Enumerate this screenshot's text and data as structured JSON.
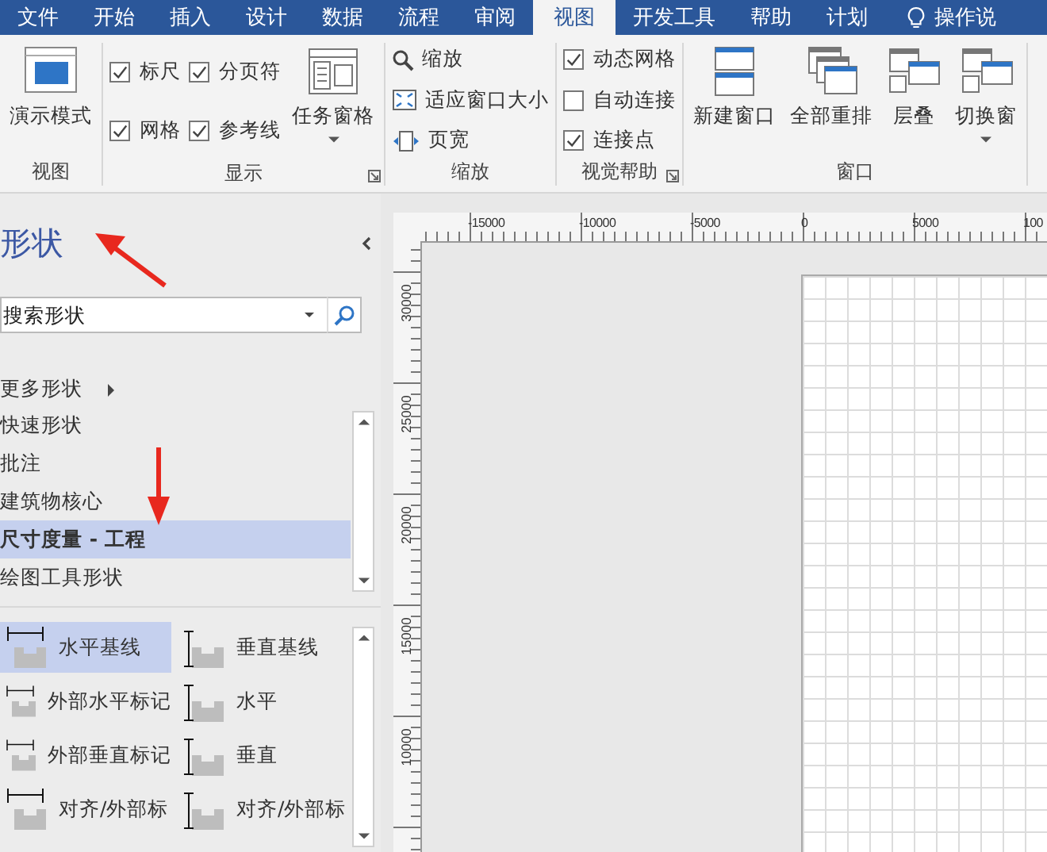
{
  "tabs": [
    {
      "label": "文件",
      "selected": false
    },
    {
      "label": "开始",
      "selected": false
    },
    {
      "label": "插入",
      "selected": false
    },
    {
      "label": "设计",
      "selected": false
    },
    {
      "label": "数据",
      "selected": false
    },
    {
      "label": "流程",
      "selected": false
    },
    {
      "label": "审阅",
      "selected": false
    },
    {
      "label": "视图",
      "selected": true
    },
    {
      "label": "开发工具",
      "selected": false
    },
    {
      "label": "帮助",
      "selected": false
    },
    {
      "label": "计划",
      "selected": false
    }
  ],
  "tell_me": {
    "label": "操作说"
  },
  "ribbon": {
    "groups": [
      {
        "label": "视图",
        "launcher": false,
        "controls": [
          {
            "kind": "big",
            "label": "演示模式",
            "dropdown": false
          }
        ]
      },
      {
        "label": "显示",
        "launcher": true,
        "controls": [
          {
            "kind": "stack",
            "items": [
              {
                "kind": "checkbox",
                "label": "标尺",
                "checked": true
              },
              {
                "kind": "checkbox",
                "label": "网格",
                "checked": true
              }
            ]
          },
          {
            "kind": "stack",
            "items": [
              {
                "kind": "checkbox",
                "label": "分页符",
                "checked": true
              },
              {
                "kind": "checkbox",
                "label": "参考线",
                "checked": true
              }
            ]
          },
          {
            "kind": "big",
            "label": "任务窗格",
            "dropdown": true
          }
        ]
      },
      {
        "label": "缩放",
        "launcher": false,
        "controls": [
          {
            "kind": "stack",
            "items": [
              {
                "kind": "small",
                "label": "缩放"
              },
              {
                "kind": "small",
                "label": "适应窗口大小"
              },
              {
                "kind": "small",
                "label": "页宽"
              }
            ]
          }
        ]
      },
      {
        "label": "视觉帮助",
        "launcher": true,
        "controls": [
          {
            "kind": "stack",
            "items": [
              {
                "kind": "checkbox",
                "label": "动态网格",
                "checked": true
              },
              {
                "kind": "checkbox",
                "label": "自动连接",
                "checked": false
              },
              {
                "kind": "checkbox",
                "label": "连接点",
                "checked": true
              }
            ]
          }
        ]
      },
      {
        "label": "窗口",
        "launcher": false,
        "controls": [
          {
            "kind": "big",
            "label": "新建窗口",
            "dropdown": false
          },
          {
            "kind": "big",
            "label": "全部重排",
            "dropdown": false
          },
          {
            "kind": "big",
            "label": "层叠",
            "dropdown": false
          },
          {
            "kind": "big",
            "label": "切换窗",
            "dropdown": true
          }
        ]
      }
    ]
  },
  "shapes_pane": {
    "title": "形状",
    "search": {
      "placeholder": "搜索形状"
    },
    "more_shapes": "更多形状",
    "stencils": [
      {
        "label": "快速形状",
        "selected": false
      },
      {
        "label": "批注",
        "selected": false
      },
      {
        "label": "建筑物核心",
        "selected": false
      },
      {
        "label": "尺寸度量 - 工程",
        "selected": true
      },
      {
        "label": "绘图工具形状",
        "selected": false
      }
    ],
    "shapes": [
      {
        "label": "水平基线",
        "selected": true
      },
      {
        "label": "垂直基线",
        "selected": false
      },
      {
        "label": "外部水平标记",
        "selected": false
      },
      {
        "label": "水平",
        "selected": false
      },
      {
        "label": "外部垂直标记",
        "selected": false
      },
      {
        "label": "垂直",
        "selected": false
      },
      {
        "label": "对齐/外部标",
        "selected": false
      },
      {
        "label": "对齐/外部标",
        "selected": false
      }
    ]
  },
  "rulers": {
    "horizontal": [
      "-15000",
      "-10000",
      "-5000",
      "0",
      "5000",
      "100"
    ],
    "vertical": [
      "30000",
      "25000",
      "20000",
      "15000",
      "10000"
    ]
  }
}
